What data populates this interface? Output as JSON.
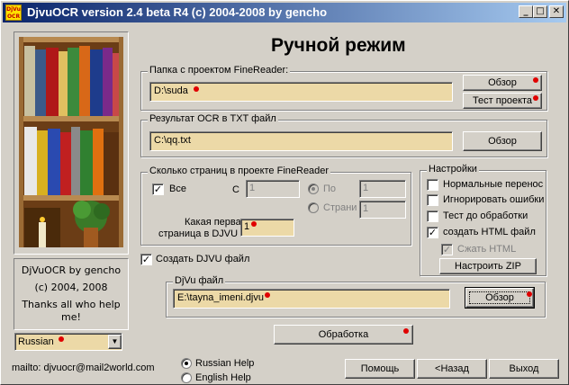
{
  "window": {
    "title": "DjvuOCR version 2.4 beta R4 (c) 2004-2008 by gencho",
    "icon_text_top": "DjVu",
    "icon_text_bottom": "OCR",
    "minimize": "_",
    "maximize": "□",
    "close": "✕"
  },
  "heading": "Ручной режим",
  "about": {
    "line1": "DjVuOCR by gencho",
    "line2": "(c) 2004, 2008",
    "line3": "Thanks all who help me!"
  },
  "language_select": {
    "value": "Russian"
  },
  "mailto": "mailto: djvuocr@mail2world.com",
  "help_language": {
    "options": [
      "Russian Help",
      "English Help"
    ],
    "selected": "Russian Help"
  },
  "finereader_project": {
    "title": "Папка с проектом FineReader:",
    "path": "D:\\suda",
    "browse_label": "Обзор",
    "test_label": "Тест проекта"
  },
  "ocr_result": {
    "title": "Результат OCR в TXT файл",
    "path": "C:\\qq.txt",
    "browse_label": "Обзор"
  },
  "pages": {
    "title": "Сколько страниц в проекте FineReader",
    "all_label": "Все",
    "all_checked": true,
    "from_label": "С",
    "from_value": "1",
    "to_label": "По",
    "to_value": "1",
    "page_label": "Страни",
    "page_value": "1",
    "first_page_label_1": "Какая первая",
    "first_page_label_2": "страница в DJVU",
    "first_page_value": "1"
  },
  "settings": {
    "title": "Настройки",
    "normal_wrap": "Нормальные перенос",
    "normal_wrap_checked": false,
    "ignore_errors": "Игнорировать ошибки",
    "ignore_errors_checked": false,
    "pre_test": "Тест до обработки",
    "pre_test_checked": false,
    "create_html": "создать HTML файл",
    "create_html_checked": true,
    "compress_html": "Сжать HTML",
    "compress_html_checked": true,
    "zip_button": "Настроить ZIP"
  },
  "create_djvu": {
    "label": "Создать DJVU файл",
    "checked": true
  },
  "djvu_file": {
    "title": "DjVu файл",
    "path": "E:\\tayna_imeni.djvu",
    "browse_label": "Обзор"
  },
  "process_button": "Обработка",
  "footer": {
    "help_button": "Помощь",
    "back_button": "<Назад",
    "exit_button": "Выход"
  },
  "colors": {
    "field_bg": "#ecd9a7",
    "title_gradient_start": "#0a246a",
    "title_gradient_end": "#a6caf0",
    "marker_red": "#e00000"
  }
}
